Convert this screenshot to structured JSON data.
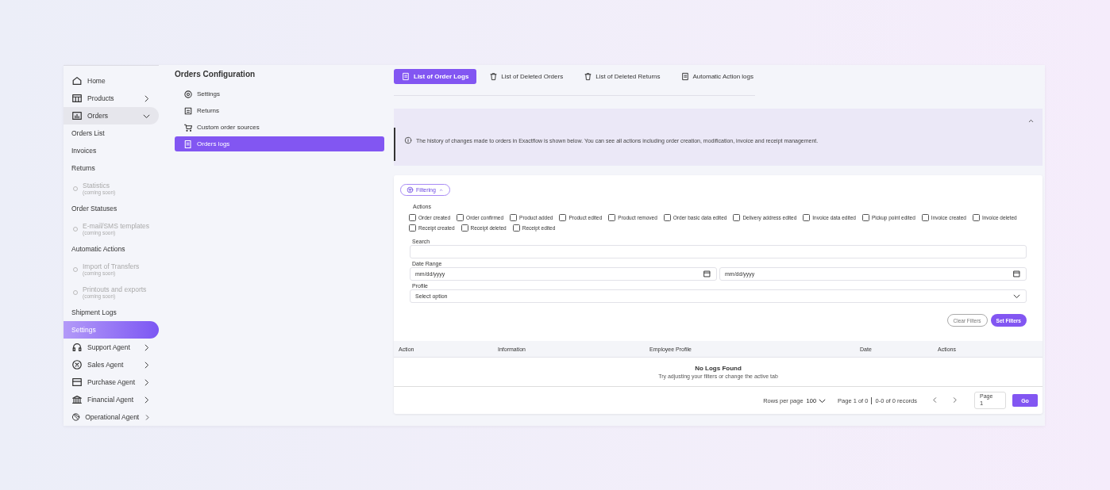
{
  "sidebar": {
    "items": [
      {
        "kind": "top",
        "label": "Home",
        "selected": false
      },
      {
        "kind": "group",
        "label": "Products",
        "expanded": false,
        "selected": false
      },
      {
        "kind": "group",
        "label": "Orders",
        "expanded": true,
        "selected": false
      },
      {
        "kind": "sub",
        "label": "Orders List",
        "selected": false
      },
      {
        "kind": "sub",
        "label": "Invoices",
        "selected": false
      },
      {
        "kind": "sub",
        "label": "Returns",
        "selected": false
      },
      {
        "kind": "soon",
        "label": "Statistics",
        "note": "(coming soon)",
        "selected": false
      },
      {
        "kind": "sub",
        "label": "Order Statuses",
        "selected": false
      },
      {
        "kind": "soon",
        "label": "E-mail/SMS templates",
        "note": "(coming soon)",
        "selected": false
      },
      {
        "kind": "sub",
        "label": "Automatic Actions",
        "selected": false
      },
      {
        "kind": "soon",
        "label": "Import of Transfers",
        "note": "(coming soon)",
        "selected": false
      },
      {
        "kind": "soon",
        "label": "Printouts and exports",
        "note": "(coming soon)",
        "selected": false
      },
      {
        "kind": "sub",
        "label": "Shipment Logs",
        "selected": false
      },
      {
        "kind": "sub",
        "label": "Settings",
        "selected": true
      },
      {
        "kind": "group",
        "label": "Support Agent",
        "expanded": false,
        "selected": false
      },
      {
        "kind": "group",
        "label": "Sales Agent",
        "expanded": false,
        "selected": false
      },
      {
        "kind": "group",
        "label": "Purchase Agent",
        "expanded": false,
        "selected": false
      },
      {
        "kind": "group",
        "label": "Financial Agent",
        "expanded": false,
        "selected": false
      },
      {
        "kind": "group",
        "label": "Operational Agent",
        "expanded": false,
        "selected": false
      }
    ]
  },
  "config": {
    "title": "Orders Configuration",
    "items": [
      {
        "label": "Settings",
        "selected": false
      },
      {
        "label": "Returns",
        "selected": false
      },
      {
        "label": "Custom order sources",
        "selected": false
      },
      {
        "label": "Orders logs",
        "selected": true
      }
    ]
  },
  "tabs": [
    {
      "label": "List of Order Logs",
      "selected": true
    },
    {
      "label": "List of Deleted Orders",
      "selected": false
    },
    {
      "label": "List of Deleted Returns",
      "selected": false
    },
    {
      "label": "Automatic Action logs",
      "selected": false
    }
  ],
  "info": {
    "text": "The history of changes made to orders in Exactflow is shown below. You can see all actions including order creation, modification, invoice and receipt management.",
    "expanded": true
  },
  "filters": {
    "toggle": "Filtering",
    "expanded": true,
    "actions_label": "Actions",
    "actions": [
      {
        "label": "Order created",
        "checked": false
      },
      {
        "label": "Order confirmed",
        "checked": false
      },
      {
        "label": "Product added",
        "checked": false
      },
      {
        "label": "Product edited",
        "checked": false
      },
      {
        "label": "Product removed",
        "checked": false
      },
      {
        "label": "Order basic data edited",
        "checked": false
      },
      {
        "label": "Delivery address edited",
        "checked": false
      },
      {
        "label": "Invoice data edited",
        "checked": false
      },
      {
        "label": "Pickup point edited",
        "checked": false
      },
      {
        "label": "Invoice created",
        "checked": false
      },
      {
        "label": "Invoice deleted",
        "checked": false
      },
      {
        "label": "Receipt created",
        "checked": false
      },
      {
        "label": "Receipt deleted",
        "checked": false
      },
      {
        "label": "Receipt edited",
        "checked": false
      }
    ],
    "search_label": "Search",
    "date_label": "Date Range",
    "date_from": "mm/dd/yyyy",
    "date_to": "mm/dd/yyyy",
    "profile_label": "Profile",
    "profile_placeholder": "Select option",
    "clear": "Clear Filters",
    "apply": "Set Filters"
  },
  "table": {
    "columns": [
      "Action",
      "Information",
      "Employee Profile",
      "Date",
      "Actions"
    ],
    "empty_title": "No Logs Found",
    "empty_text": "Try adjusting your filters or change the active tab"
  },
  "pagination": {
    "rows_label": "Rows per page",
    "rows_value": "100",
    "page_info": "Page 1 of 0",
    "records": "0-0 of 0 records",
    "page_label": "Page",
    "page_value": "1",
    "go": "Go"
  }
}
